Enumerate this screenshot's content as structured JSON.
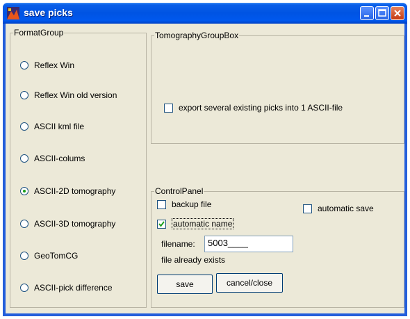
{
  "window": {
    "title": "save picks",
    "controls": {
      "minimize": "minimize-icon",
      "maximize": "maximize-icon",
      "close": "close-icon"
    }
  },
  "format_group": {
    "title": "FormatGroup",
    "options": [
      {
        "label": "Reflex Win",
        "selected": false
      },
      {
        "label": "Reflex Win old version",
        "selected": false
      },
      {
        "label": "ASCII kml file",
        "selected": false
      },
      {
        "label": "ASCII-colums",
        "selected": false
      },
      {
        "label": "ASCII-2D tomography",
        "selected": true
      },
      {
        "label": "ASCII-3D tomography",
        "selected": false
      },
      {
        "label": "GeoTomCG",
        "selected": false
      },
      {
        "label": "ASCII-pick difference",
        "selected": false
      }
    ]
  },
  "tomography_group": {
    "title": "TomographyGroupBox",
    "export_label": "export several existing picks into 1 ASCII-file",
    "export_checked": false
  },
  "control_panel": {
    "title": "ControlPanel",
    "backup_label": "backup file",
    "backup_checked": false,
    "automatic_save_label": "automatic save",
    "automatic_save_checked": false,
    "automatic_name_label": "automatic name",
    "automatic_name_checked": true,
    "filename_label": "filename:",
    "filename_value": "5003____",
    "status": "file already exists",
    "save_label": "save",
    "cancel_label": "cancel/close"
  },
  "colors": {
    "titlebar": "#0054e3",
    "client": "#ece9d8",
    "check_green": "#21a121"
  }
}
